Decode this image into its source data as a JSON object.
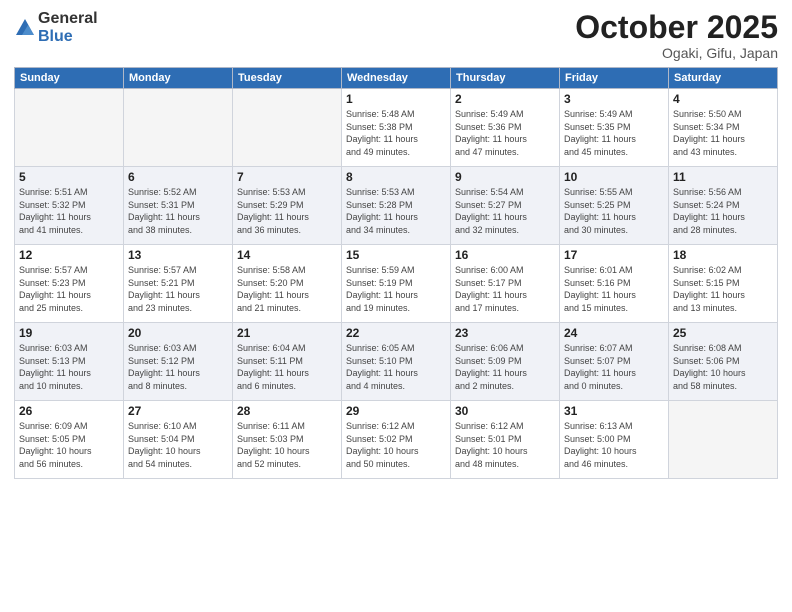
{
  "header": {
    "logo_general": "General",
    "logo_blue": "Blue",
    "month": "October 2025",
    "location": "Ogaki, Gifu, Japan"
  },
  "weekdays": [
    "Sunday",
    "Monday",
    "Tuesday",
    "Wednesday",
    "Thursday",
    "Friday",
    "Saturday"
  ],
  "weeks": [
    [
      {
        "day": "",
        "info": ""
      },
      {
        "day": "",
        "info": ""
      },
      {
        "day": "",
        "info": ""
      },
      {
        "day": "1",
        "info": "Sunrise: 5:48 AM\nSunset: 5:38 PM\nDaylight: 11 hours\nand 49 minutes."
      },
      {
        "day": "2",
        "info": "Sunrise: 5:49 AM\nSunset: 5:36 PM\nDaylight: 11 hours\nand 47 minutes."
      },
      {
        "day": "3",
        "info": "Sunrise: 5:49 AM\nSunset: 5:35 PM\nDaylight: 11 hours\nand 45 minutes."
      },
      {
        "day": "4",
        "info": "Sunrise: 5:50 AM\nSunset: 5:34 PM\nDaylight: 11 hours\nand 43 minutes."
      }
    ],
    [
      {
        "day": "5",
        "info": "Sunrise: 5:51 AM\nSunset: 5:32 PM\nDaylight: 11 hours\nand 41 minutes."
      },
      {
        "day": "6",
        "info": "Sunrise: 5:52 AM\nSunset: 5:31 PM\nDaylight: 11 hours\nand 38 minutes."
      },
      {
        "day": "7",
        "info": "Sunrise: 5:53 AM\nSunset: 5:29 PM\nDaylight: 11 hours\nand 36 minutes."
      },
      {
        "day": "8",
        "info": "Sunrise: 5:53 AM\nSunset: 5:28 PM\nDaylight: 11 hours\nand 34 minutes."
      },
      {
        "day": "9",
        "info": "Sunrise: 5:54 AM\nSunset: 5:27 PM\nDaylight: 11 hours\nand 32 minutes."
      },
      {
        "day": "10",
        "info": "Sunrise: 5:55 AM\nSunset: 5:25 PM\nDaylight: 11 hours\nand 30 minutes."
      },
      {
        "day": "11",
        "info": "Sunrise: 5:56 AM\nSunset: 5:24 PM\nDaylight: 11 hours\nand 28 minutes."
      }
    ],
    [
      {
        "day": "12",
        "info": "Sunrise: 5:57 AM\nSunset: 5:23 PM\nDaylight: 11 hours\nand 25 minutes."
      },
      {
        "day": "13",
        "info": "Sunrise: 5:57 AM\nSunset: 5:21 PM\nDaylight: 11 hours\nand 23 minutes."
      },
      {
        "day": "14",
        "info": "Sunrise: 5:58 AM\nSunset: 5:20 PM\nDaylight: 11 hours\nand 21 minutes."
      },
      {
        "day": "15",
        "info": "Sunrise: 5:59 AM\nSunset: 5:19 PM\nDaylight: 11 hours\nand 19 minutes."
      },
      {
        "day": "16",
        "info": "Sunrise: 6:00 AM\nSunset: 5:17 PM\nDaylight: 11 hours\nand 17 minutes."
      },
      {
        "day": "17",
        "info": "Sunrise: 6:01 AM\nSunset: 5:16 PM\nDaylight: 11 hours\nand 15 minutes."
      },
      {
        "day": "18",
        "info": "Sunrise: 6:02 AM\nSunset: 5:15 PM\nDaylight: 11 hours\nand 13 minutes."
      }
    ],
    [
      {
        "day": "19",
        "info": "Sunrise: 6:03 AM\nSunset: 5:13 PM\nDaylight: 11 hours\nand 10 minutes."
      },
      {
        "day": "20",
        "info": "Sunrise: 6:03 AM\nSunset: 5:12 PM\nDaylight: 11 hours\nand 8 minutes."
      },
      {
        "day": "21",
        "info": "Sunrise: 6:04 AM\nSunset: 5:11 PM\nDaylight: 11 hours\nand 6 minutes."
      },
      {
        "day": "22",
        "info": "Sunrise: 6:05 AM\nSunset: 5:10 PM\nDaylight: 11 hours\nand 4 minutes."
      },
      {
        "day": "23",
        "info": "Sunrise: 6:06 AM\nSunset: 5:09 PM\nDaylight: 11 hours\nand 2 minutes."
      },
      {
        "day": "24",
        "info": "Sunrise: 6:07 AM\nSunset: 5:07 PM\nDaylight: 11 hours\nand 0 minutes."
      },
      {
        "day": "25",
        "info": "Sunrise: 6:08 AM\nSunset: 5:06 PM\nDaylight: 10 hours\nand 58 minutes."
      }
    ],
    [
      {
        "day": "26",
        "info": "Sunrise: 6:09 AM\nSunset: 5:05 PM\nDaylight: 10 hours\nand 56 minutes."
      },
      {
        "day": "27",
        "info": "Sunrise: 6:10 AM\nSunset: 5:04 PM\nDaylight: 10 hours\nand 54 minutes."
      },
      {
        "day": "28",
        "info": "Sunrise: 6:11 AM\nSunset: 5:03 PM\nDaylight: 10 hours\nand 52 minutes."
      },
      {
        "day": "29",
        "info": "Sunrise: 6:12 AM\nSunset: 5:02 PM\nDaylight: 10 hours\nand 50 minutes."
      },
      {
        "day": "30",
        "info": "Sunrise: 6:12 AM\nSunset: 5:01 PM\nDaylight: 10 hours\nand 48 minutes."
      },
      {
        "day": "31",
        "info": "Sunrise: 6:13 AM\nSunset: 5:00 PM\nDaylight: 10 hours\nand 46 minutes."
      },
      {
        "day": "",
        "info": ""
      }
    ]
  ]
}
